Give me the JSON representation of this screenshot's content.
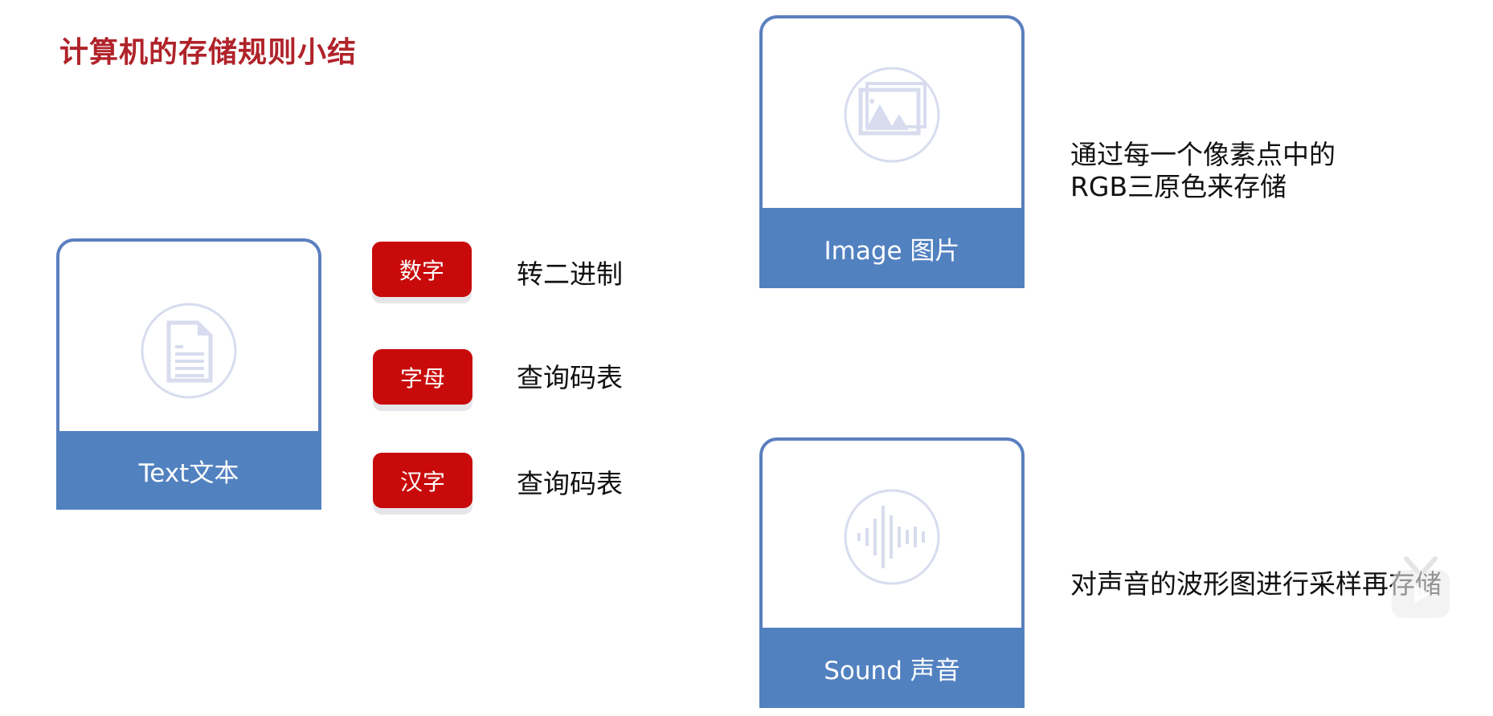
{
  "title": "计算机的存储规则小结",
  "colors": {
    "title": "#b0232a",
    "card_border": "#5b7fbf",
    "card_footer": "#5281c0",
    "badge": "#c80a0a",
    "icon": "#d8dcee"
  },
  "cards": [
    {
      "label": "Text文本",
      "icon": "document-icon"
    },
    {
      "label": "Image 图片",
      "icon": "image-icon"
    },
    {
      "label": "Sound 声音",
      "icon": "sound-wave-icon"
    }
  ],
  "text_rules": [
    {
      "badge": "数字",
      "desc": "转二进制"
    },
    {
      "badge": "字母",
      "desc": "查询码表"
    },
    {
      "badge": "汉字",
      "desc": "查询码表"
    }
  ],
  "image_desc": {
    "line1": "通过每一个像素点中的",
    "line2": "RGB三原色来存储"
  },
  "sound_desc": "对声音的波形图进行采样再存储",
  "watermark_icon": "video-player-icon"
}
